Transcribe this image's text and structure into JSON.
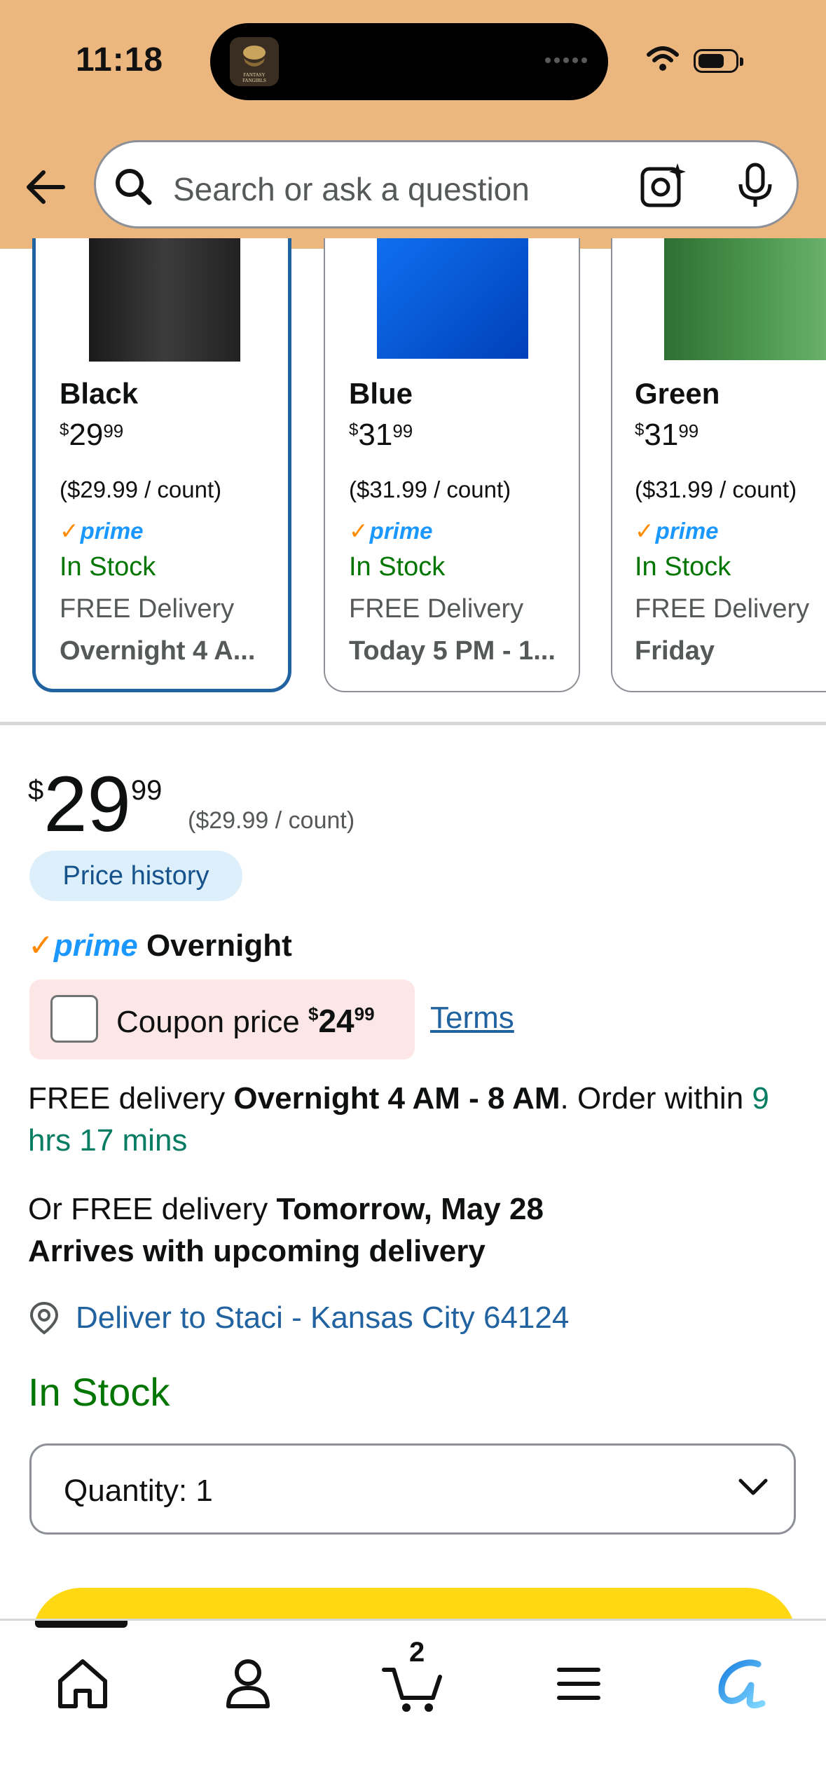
{
  "status_bar": {
    "time": "11:18",
    "app_icon": "fantasy-fangirls-icon",
    "app_icon_text": "FANTASY FANGIRLS"
  },
  "header": {
    "search_placeholder": "Search or ask a question"
  },
  "colors": {
    "header_bg": "#ebb77f",
    "link": "#2162a1",
    "in_stock": "#007600",
    "prime": "#1a98ff",
    "buy_button": "#ffd814",
    "coupon_bg": "#fde6e6"
  },
  "variations": [
    {
      "name": "Black",
      "currency": "$",
      "dollars": "29",
      "cents": "99",
      "unit_price": "($29.99 / count)",
      "prime": "prime",
      "stock": "In Stock",
      "free": "FREE Delivery",
      "delivery": "Overnight 4 A...",
      "selected": true,
      "swatch": "#2b2b2b"
    },
    {
      "name": "Blue",
      "currency": "$",
      "dollars": "31",
      "cents": "99",
      "unit_price": "($31.99 / count)",
      "prime": "prime",
      "stock": "In Stock",
      "free": "FREE Delivery",
      "delivery": "Today 5 PM - 1...",
      "selected": false,
      "swatch": "#0a52d6"
    },
    {
      "name": "Green",
      "currency": "$",
      "dollars": "31",
      "cents": "99",
      "unit_price": "($31.99 / count)",
      "prime": "prime",
      "stock": "In Stock",
      "free": "FREE Delivery",
      "delivery": "Friday",
      "selected": false,
      "swatch": "#3f8a43"
    }
  ],
  "price": {
    "currency": "$",
    "dollars": "29",
    "cents": "99",
    "unit_price": "($29.99 / count)",
    "history_label": "Price history"
  },
  "prime_badge": {
    "prime": "prime",
    "label": "Overnight"
  },
  "coupon": {
    "label": "Coupon price",
    "currency": "$",
    "dollars": "24",
    "cents": "99",
    "terms": "Terms"
  },
  "delivery": {
    "prefix": "FREE delivery ",
    "window": "Overnight 4 AM - 8 AM",
    "order_within_prefix": ". Order within ",
    "order_within": "9 hrs 17 mins",
    "alt_prefix": "Or FREE delivery ",
    "alt_date": "Tomorrow, May 28",
    "alt_note": "Arrives with upcoming delivery"
  },
  "deliver_to": "Deliver to Staci - Kansas City 64124",
  "stock_status": "In Stock",
  "quantity": {
    "label": "Quantity:",
    "value": "1"
  },
  "tabbar": {
    "cart_count": "2",
    "tabs": [
      "home-icon",
      "account-icon",
      "cart-icon",
      "menu-icon",
      "rufus-assistant-icon"
    ]
  }
}
